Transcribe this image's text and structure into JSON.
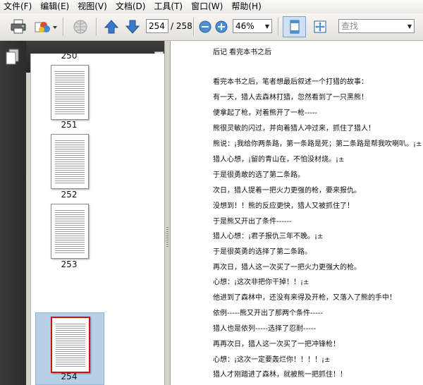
{
  "menu": [
    "文件(F)",
    "编辑(E)",
    "视图(V)",
    "文档(D)",
    "工具(T)",
    "窗口(W)",
    "帮助(H)"
  ],
  "toolbar": {
    "current_page": "254",
    "total_pages": "/ 258",
    "zoom": "46%",
    "search_placeholder": "查找"
  },
  "sidebar": {
    "panel_title": "页面",
    "thumbnails": [
      {
        "page": "250"
      },
      {
        "page": "251"
      },
      {
        "page": "252"
      },
      {
        "page": "253"
      },
      {
        "page": "254",
        "selected": true
      }
    ]
  },
  "document": {
    "heading": "后记 看完本书之后",
    "lines": [
      "看完本书之后，笔者想最后叙述一个打猎的故事：",
      "有一天，猎人去森林打猎，忽然看到了一只黑熊！",
      "便拿起了枪，对着熊开了一枪-----",
      "熊很灵敏的闪过，并向着猎人冲过来，抓住了猎人！",
      "熊说：¡我给你两条路，第一条路是死；第二条路是帮我吹喇叭。¡±",
      "猎人心想，¡留的青山在，不怕没材烧。¡±",
      "于是很勇敢的选了第二条路。",
      "次日，猎人提着一把火力更强的枪，要来报仇。",
      "没想到！！熊的反应更快，猎人又被抓住了！",
      "于是熊又开出了条件------",
      "猎人心想：¡君子报仇三年不晚。¡±",
      "于是很英勇的选择了第二条路。",
      "再次日，猎人这一次买了一把火力更强大的枪。",
      "心想：¡这次非把你干掉！！¡±",
      "他进到了森林中，还没有来得及开枪，又落入了熊的手中！",
      "依例-----熊又开出了那两个条件-----",
      "猎人也是依列-----选择了忍耐-----",
      "再再次日，猎人这一次买了一把冲锋枪！",
      "心想：¡这次一定要轰烂你！！！！¡±",
      "猎人才刚踏进了森林，就被熊一把抓住！！"
    ]
  },
  "colors": {
    "selection_fill": "#b8d0e6",
    "selected_page_border": "#cc1111",
    "arrow_blue": "#3a78c8"
  }
}
